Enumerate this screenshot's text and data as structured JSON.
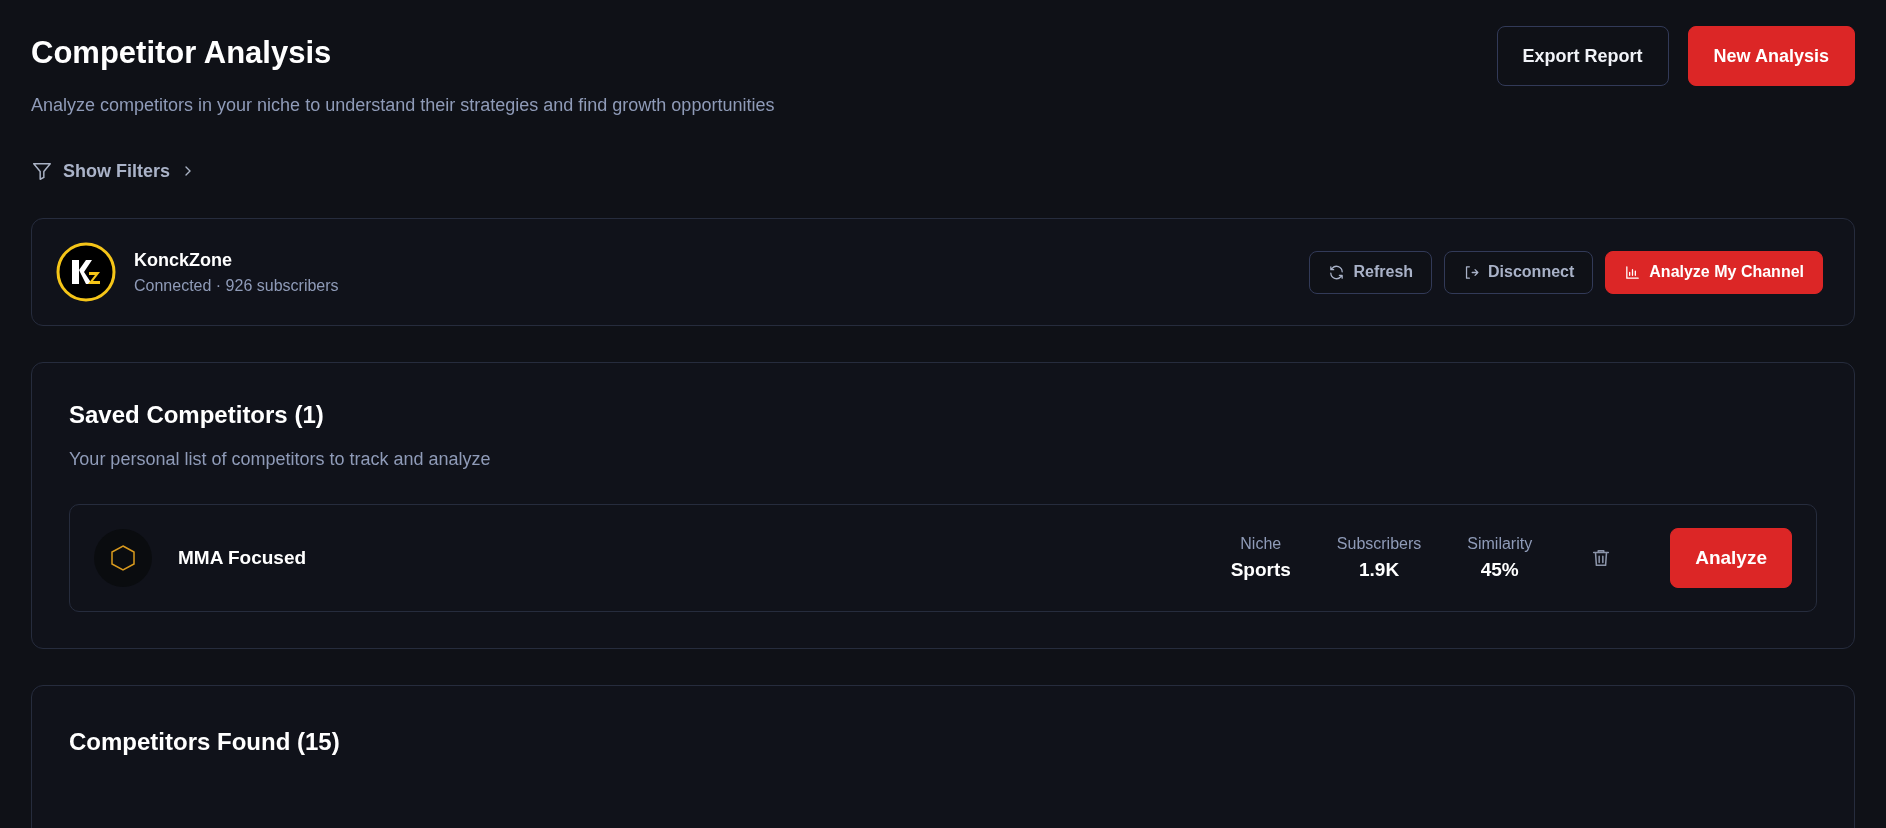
{
  "header": {
    "title": "Competitor Analysis",
    "subtitle": "Analyze competitors in your niche to understand their strategies and find growth opportunities"
  },
  "header_actions": [
    {
      "label": "Export Report",
      "kind": "outline"
    },
    {
      "label": "New Analysis",
      "kind": "primary"
    }
  ],
  "filters_toggle": {
    "label": "Show Filters",
    "expanded": false
  },
  "channel": {
    "name": "KonckZone",
    "status": "Connected · 926 subscribers",
    "actions": [
      {
        "label": "Refresh",
        "kind": "outline"
      },
      {
        "label": "Disconnect",
        "kind": "outline"
      },
      {
        "label": "Analyze My Channel",
        "kind": "primary"
      }
    ]
  },
  "saved_competitors": {
    "title": "Saved Competitors (1)",
    "subtitle": "Your personal list of competitors to track and analyze",
    "items": [
      {
        "name": "MMA Focused",
        "stats": [
          {
            "label": "Niche",
            "value": "Sports"
          },
          {
            "label": "Subscribers",
            "value": "1.9K"
          },
          {
            "label": "Similarity",
            "value": "45%"
          }
        ],
        "action": "Analyze"
      }
    ]
  },
  "competitors_found": {
    "title": "Competitors Found (15)"
  }
}
